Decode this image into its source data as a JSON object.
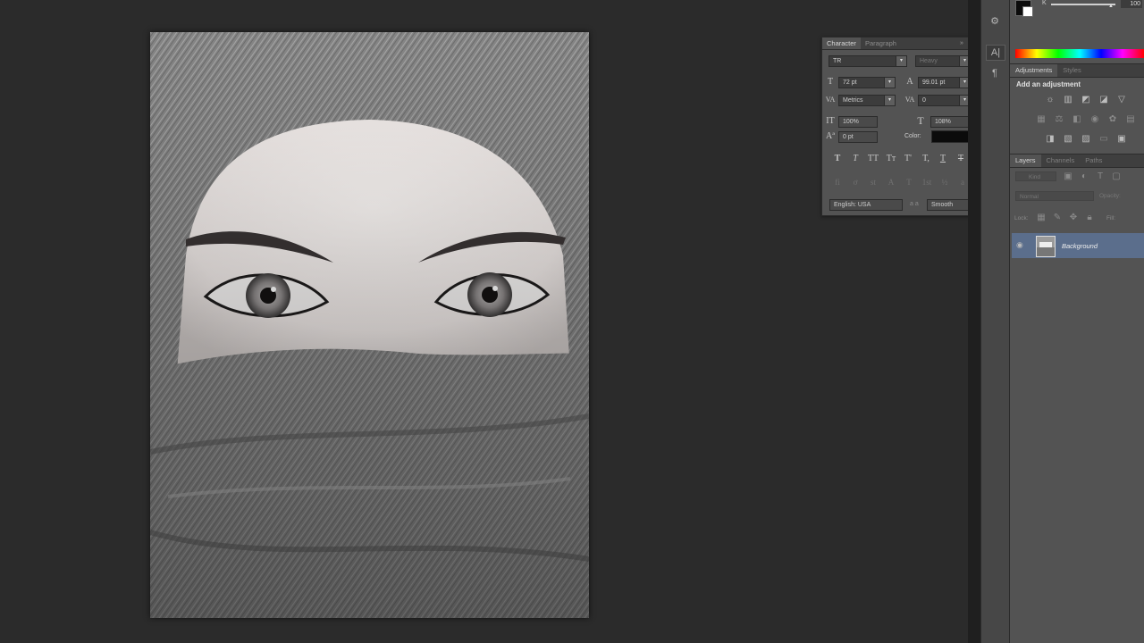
{
  "character_panel": {
    "tabs": [
      "Character",
      "Paragraph"
    ],
    "font_family": "TR",
    "font_style": "Heavy",
    "font_size": "72 pt",
    "leading": "99.01 pt",
    "kerning": "Metrics",
    "tracking": "0",
    "vertical_scale": "100%",
    "horizontal_scale": "108%",
    "baseline_shift": "0 pt",
    "color_label": "Color:",
    "color_value": "#0b0b0b",
    "language": "English: USA",
    "aa_label": "a a",
    "antialias": "Smooth"
  },
  "adjustments_panel": {
    "tabs": [
      "Adjustments",
      "Styles"
    ],
    "heading": "Add an adjustment"
  },
  "layers_panel": {
    "tabs": [
      "Layers",
      "Channels",
      "Paths"
    ],
    "filter_kind": "Kind",
    "blend_mode": "Normal",
    "opacity_label": "Opacity:",
    "lock_label": "Lock:",
    "fill_label": "Fill:",
    "layer_name": "Background"
  },
  "color_panel": {
    "value": "100",
    "k_label": "K"
  },
  "colors": {
    "workspace": "#2b2b2b",
    "panel": "#535353",
    "selected_layer": "#5b6e8c"
  }
}
